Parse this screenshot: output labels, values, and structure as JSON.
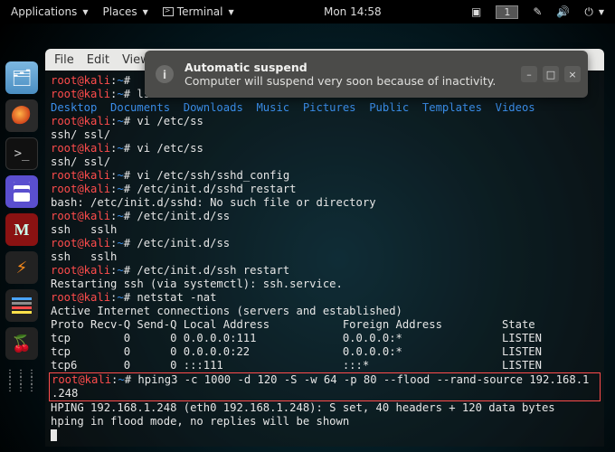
{
  "topbar": {
    "applications": "Applications",
    "places": "Places",
    "terminal": "Terminal",
    "clock": "Mon 14:58",
    "workspace": "1"
  },
  "dock": {
    "items": [
      {
        "name": "files-icon"
      },
      {
        "name": "firefox-icon"
      },
      {
        "name": "terminal-icon"
      },
      {
        "name": "text-editor-icon"
      },
      {
        "name": "metasploit-icon"
      },
      {
        "name": "zenmap-icon"
      },
      {
        "name": "wireshark-icon"
      },
      {
        "name": "cherrytree-icon"
      },
      {
        "name": "show-apps-icon"
      }
    ]
  },
  "menubar": {
    "file": "File",
    "edit": "Edit",
    "view": "View"
  },
  "notification": {
    "title": "Automatic suspend",
    "body": "Computer will suspend very soon because of inactivity."
  },
  "prompt": {
    "userhost": "root@kali",
    "sep": ":",
    "path": "~",
    "hash": "#"
  },
  "term": {
    "l01_cmd": "",
    "l02_cmd": " ls",
    "l03_dirs": "Desktop  Documents  Downloads  Music  Pictures  Public  Templates  Videos",
    "l04_cmd": " vi /etc/ss",
    "l05": "ssh/ ssl/",
    "l06_cmd": " vi /etc/ss",
    "l07": "ssh/ ssl/",
    "l08_cmd": " vi /etc/ssh/sshd_config",
    "l09_cmd": " /etc/init.d/sshd restart",
    "l10": "bash: /etc/init.d/sshd: No such file or directory",
    "l11_cmd": " /etc/init.d/ss",
    "l12": "ssh   sslh",
    "l13_cmd": " /etc/init.d/ss",
    "l14": "ssh   sslh",
    "l15_cmd": " /etc/init.d/ssh restart",
    "l16": "Restarting ssh (via systemctl): ssh.service.",
    "l17_cmd": " netstat -nat",
    "l18": "Active Internet connections (servers and established)",
    "l19": "Proto Recv-Q Send-Q Local Address           Foreign Address         State",
    "l20": "tcp        0      0 0.0.0.0:111             0.0.0.0:*               LISTEN",
    "l21": "tcp        0      0 0.0.0.0:22              0.0.0.0:*               LISTEN",
    "l22": "tcp6       0      0 :::111                  :::*                    LISTEN",
    "l23_cmd": " hping3 -c 1000 -d 120 -S -w 64 -p 80 --flood --rand-source 192.168.1",
    "l23b": ".248",
    "l24": "HPING 192.168.1.248 (eth0 192.168.1.248): S set, 40 headers + 120 data bytes",
    "l25": "hping in flood mode, no replies will be shown"
  }
}
